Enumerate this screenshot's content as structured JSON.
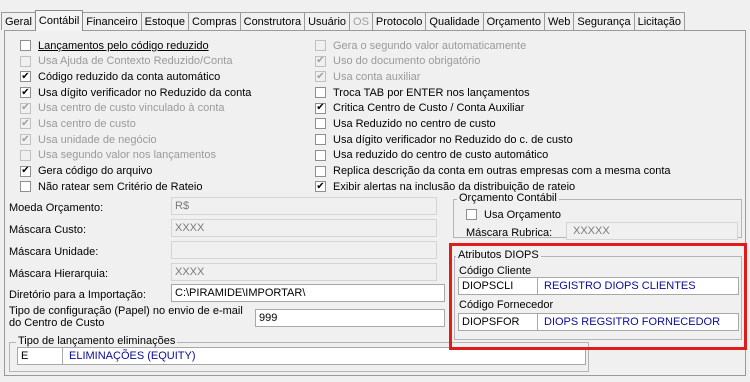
{
  "tabs": [
    {
      "label": "Geral",
      "active": false,
      "disabled": false
    },
    {
      "label": "Contábil",
      "active": true,
      "disabled": false
    },
    {
      "label": "Financeiro",
      "active": false,
      "disabled": false
    },
    {
      "label": "Estoque",
      "active": false,
      "disabled": false
    },
    {
      "label": "Compras",
      "active": false,
      "disabled": false
    },
    {
      "label": "Construtora",
      "active": false,
      "disabled": false
    },
    {
      "label": "Usuário",
      "active": false,
      "disabled": false
    },
    {
      "label": "OS",
      "active": false,
      "disabled": true
    },
    {
      "label": "Protocolo",
      "active": false,
      "disabled": false
    },
    {
      "label": "Qualidade",
      "active": false,
      "disabled": false
    },
    {
      "label": "Orçamento",
      "active": false,
      "disabled": false
    },
    {
      "label": "Web",
      "active": false,
      "disabled": false
    },
    {
      "label": "Segurança",
      "active": false,
      "disabled": false
    },
    {
      "label": "Licitação",
      "active": false,
      "disabled": false
    }
  ],
  "left_checks": [
    {
      "label": "Lançamentos pelo código reduzido",
      "checked": false,
      "disabled": false,
      "underline": true
    },
    {
      "label": "Usa Ajuda de Contexto Reduzido/Conta",
      "checked": false,
      "disabled": true
    },
    {
      "label": "Código reduzido da conta automático",
      "checked": true,
      "disabled": false
    },
    {
      "label": "Usa dígito verificador no Reduzido da conta",
      "checked": true,
      "disabled": false
    },
    {
      "label": "Usa centro de custo vinculado à conta",
      "checked": true,
      "disabled": true
    },
    {
      "label": "Usa centro de custo",
      "checked": true,
      "disabled": true
    },
    {
      "label": "Usa unidade de negócio",
      "checked": true,
      "disabled": true
    },
    {
      "label": "Usa segundo valor nos lançamentos",
      "checked": false,
      "disabled": true
    },
    {
      "label": "Gera código do arquivo",
      "checked": true,
      "disabled": false
    },
    {
      "label": "Não ratear sem Critério de Rateio",
      "checked": false,
      "disabled": false
    }
  ],
  "right_checks": [
    {
      "label": "Gera o segundo valor automaticamente",
      "checked": false,
      "disabled": true
    },
    {
      "label": "Uso do documento obrigatório",
      "checked": true,
      "disabled": true
    },
    {
      "label": "Usa conta auxiliar",
      "checked": true,
      "disabled": true
    },
    {
      "label": "Troca TAB por ENTER nos lançamentos",
      "checked": false,
      "disabled": false
    },
    {
      "label": "Critica Centro de Custo / Conta Auxiliar",
      "checked": true,
      "disabled": false
    },
    {
      "label": "Usa Reduzido no centro de custo",
      "checked": false,
      "disabled": false
    },
    {
      "label": "Usa dígito verificador no Reduzido do c. de custo",
      "checked": false,
      "disabled": false
    },
    {
      "label": "Usa reduzido do centro de custo automático",
      "checked": false,
      "disabled": false
    },
    {
      "label": "Replica descrição da conta em outras empresas com a mesma conta",
      "checked": false,
      "disabled": false
    },
    {
      "label": "Exibir alertas na inclusão da distribuição de rateio",
      "checked": true,
      "disabled": false
    }
  ],
  "fields": {
    "moeda_label": "Moeda Orçamento:",
    "moeda_value": "R$",
    "mascara_custo_label": "Máscara Custo:",
    "mascara_custo_value": "XXXX",
    "mascara_unidade_label": "Máscara Unidade:",
    "mascara_unidade_value": "",
    "mascara_hierarquia_label": "Máscara Hierarquia:",
    "mascara_hierarquia_value": "XXXX",
    "diretorio_label": "Diretório para a Importação:",
    "diretorio_value": "C:\\PIRAMIDE\\IMPORTAR\\",
    "tipo_config_label_1": "Tipo de configuração (Papel) no envio de e-mail",
    "tipo_config_label_2": "do Centro de Custo",
    "tipo_config_value": "999"
  },
  "tipo_eliminacoes": {
    "legend": "Tipo de lançamento eliminações",
    "code": "E",
    "description": "ELIMINAÇÕES (EQUITY)"
  },
  "orcamento_contabil": {
    "legend": "Orçamento Contábil",
    "usa_orcamento_label": "Usa Orçamento",
    "usa_orcamento_checked": false,
    "mascara_rubrica_label": "Máscara Rubrica:",
    "mascara_rubrica_value": "XXXXX"
  },
  "atributos_diops": {
    "legend": "Atributos DIOPS",
    "codigo_cliente_label": "Código Cliente",
    "codigo_cliente_code": "DIOPSCLI",
    "codigo_cliente_desc": "REGISTRO DIOPS CLIENTES",
    "codigo_fornecedor_label": "Código Fornecedor",
    "codigo_fornecedor_code": "DIOPSFOR",
    "codigo_fornecedor_desc": "DIOPS REGSITRO FORNECEDOR"
  },
  "colors": {
    "highlight": "#e01b1b",
    "lookup_text": "#0a0a9a"
  }
}
